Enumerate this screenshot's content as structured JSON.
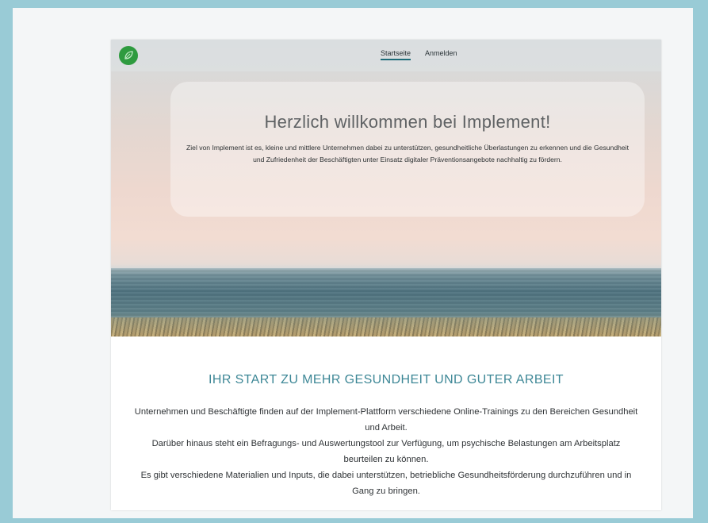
{
  "nav": {
    "links": [
      "Startseite",
      "Anmelden"
    ],
    "active_index": 0
  },
  "hero": {
    "title": "Herzlich willkommen bei Implement!",
    "text": "Ziel von Implement ist es, kleine und mittlere Unternehmen dabei zu unterstützen, gesundheitliche Überlastungen zu erkennen und die Gesundheit und Zufriedenheit der Beschäftigten unter Einsatz digitaler Präventionsangebote nachhaltig zu fördern."
  },
  "section": {
    "heading": "IHR START ZU MEHR GESUNDHEIT UND GUTER ARBEIT",
    "paragraphs": [
      "Unternehmen und Beschäftigte finden auf der Implement-Plattform verschiedene Online-Trainings zu den Bereichen Gesundheit und Arbeit.",
      "Darüber hinaus steht ein Befragungs- und Auswertungstool zur Verfügung, um psychische Belastungen am Arbeitsplatz beurteilen zu können.",
      "Es gibt verschiedene Materialien und Inputs, die dabei unterstützen, betriebliche Gesundheitsförderung durchzuführen und in Gang zu bringen."
    ]
  },
  "colors": {
    "page_background": "#99cbd6",
    "accent": "#3d8796",
    "logo": "#2e9b3f"
  }
}
